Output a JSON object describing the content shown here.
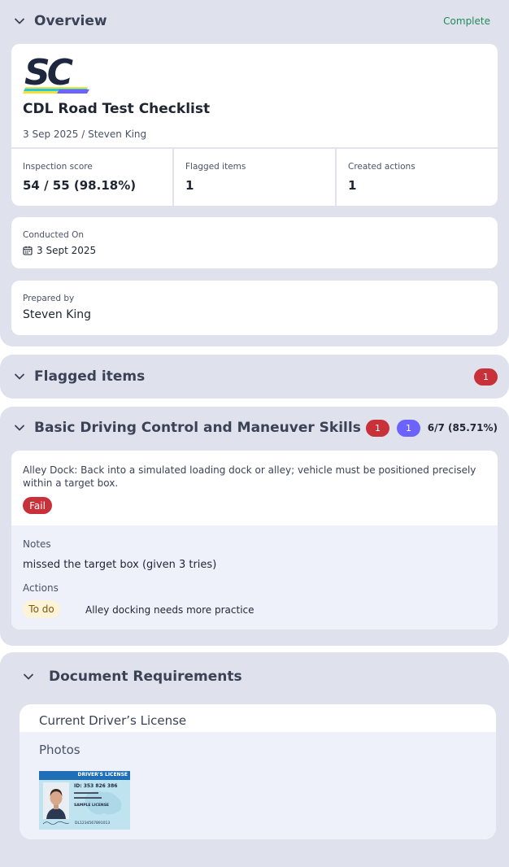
{
  "overview": {
    "title": "Overview",
    "status": "Complete",
    "logo_text": "SC",
    "report_title": "CDL Road Test Checklist",
    "meta": "3 Sep 2025 / Steven King",
    "stats": [
      {
        "label": "Inspection score",
        "value": "54 / 55 (98.18%)"
      },
      {
        "label": "Flagged items",
        "value": "1"
      },
      {
        "label": "Created actions",
        "value": "1"
      }
    ],
    "conducted_on": {
      "label": "Conducted On",
      "value": "3 Sept 2025"
    },
    "prepared_by": {
      "label": "Prepared by",
      "value": "Steven King"
    }
  },
  "flagged": {
    "title": "Flagged items",
    "count": "1"
  },
  "basic": {
    "title": "Basic Driving Control and Maneuver Skills",
    "flag_count": "1",
    "action_count": "1",
    "score": "6/7 (85.71%)",
    "item": {
      "question": "Alley Dock: Back into a simulated loading dock or alley; vehicle must be positioned precisely within a target box.",
      "result": "Fail",
      "notes_label": "Notes",
      "notes": "missed the target box (given 3 tries)",
      "actions_label": "Actions",
      "action_status": "To do",
      "action_text": "Alley docking needs more practice"
    }
  },
  "docs": {
    "title": "Document Requirements",
    "item_title": "Current Driver’s License",
    "photos_label": "Photos",
    "license": {
      "header": "DRIVER'S LICENSE",
      "id": "ID: 353 826 386",
      "sample": "SAMPLE LICENSE",
      "number": "DL1234567891013"
    }
  },
  "colors": {
    "section_bg": "#dfe2ec",
    "complete_green": "#1f8a5b",
    "fail_red": "#c8303a",
    "action_purple": "#6c63ff",
    "todo_bg": "#fdf3d6"
  }
}
